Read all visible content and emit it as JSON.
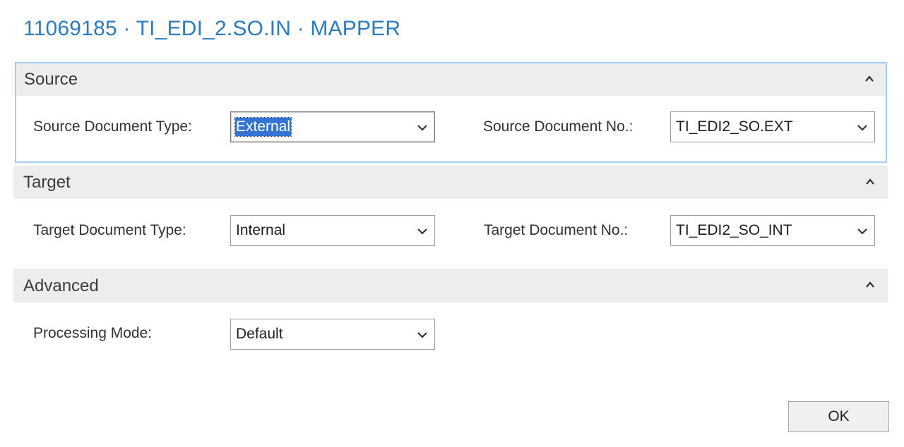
{
  "window": {
    "title": "11069185 · TI_EDI_2.SO.IN · MAPPER"
  },
  "sections": {
    "source": {
      "title": "Source",
      "collapse_icon": "chevron-up-icon",
      "source_document_type_label": "Source Document Type:",
      "source_document_type_value": "External",
      "source_document_no_label": "Source Document No.:",
      "source_document_no_value": "TI_EDI2_SO.EXT"
    },
    "target": {
      "title": "Target",
      "collapse_icon": "chevron-up-icon",
      "target_document_type_label": "Target Document Type:",
      "target_document_type_value": "Internal",
      "target_document_no_label": "Target Document No.:",
      "target_document_no_value": "TI_EDI2_SO_INT"
    },
    "advanced": {
      "title": "Advanced",
      "collapse_icon": "chevron-up-icon",
      "processing_mode_label": "Processing Mode:",
      "processing_mode_value": "Default"
    }
  },
  "footer": {
    "ok_label": "OK"
  },
  "colors": {
    "title": "#2b7bc0",
    "section_header_bg": "#ededed",
    "focus_border": "#a9c9ee",
    "selection": "#3373d1"
  }
}
